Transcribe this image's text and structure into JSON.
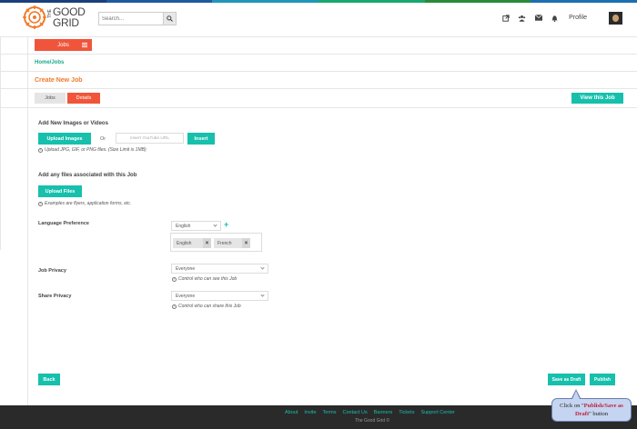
{
  "header": {
    "logo_the": "THE",
    "logo_good": "GOOD",
    "logo_grid": "GRID",
    "search_placeholder": "Search...",
    "profile_label": "Profile",
    "stripe_colors": [
      "#1a3f7a",
      "#1e5aa0",
      "#2196b8",
      "#16a86e",
      "#2a8a3a",
      "#1a6fb0"
    ]
  },
  "menu": {
    "jobs_label": "Jobs"
  },
  "breadcrumb": "Home/Jobs",
  "page_title": "Create New Job",
  "tabs": [
    {
      "label": "Jobs"
    },
    {
      "label": "Details"
    }
  ],
  "view_job_label": "View this Job",
  "images": {
    "title": "Add New Images or Videos",
    "upload_label": "Upload Images",
    "or_label": "Or",
    "url_placeholder": "Insert YouTube URL",
    "insert_label": "Insert",
    "hint": "Upload JPG, GIF, or PNG files.  (Size Limit is 1MB)"
  },
  "files": {
    "title": "Add any files associated with this Job",
    "upload_label": "Upload Files",
    "hint": "Examples are flyers, application forms, etc."
  },
  "language": {
    "label": "Language Preference",
    "select_value": "English",
    "tags": [
      "English",
      "French"
    ]
  },
  "job_privacy": {
    "label": "Job  Privacy",
    "value": "Everyone",
    "hint": "Control who can see this Job"
  },
  "share_privacy": {
    "label": "Share Privacy",
    "value": "Everyone",
    "hint": "Control who can share  this Job"
  },
  "actions": {
    "back_label": "Back",
    "draft_label": "Save as Draft",
    "publish_label": "Publish"
  },
  "footer": {
    "links": [
      "About",
      "Invite",
      "Terms",
      "Contact Us",
      "Banners",
      "Tickets",
      "Support Center"
    ],
    "copyright": "The Good Grid ©"
  },
  "callout": {
    "prefix": "Click on \"",
    "emphasis": "Publish/Save as Draft",
    "suffix": "\" button"
  },
  "colors": {
    "accent_orange": "#f0553b",
    "accent_teal": "#16c0ac",
    "title_orange": "#f07a2a",
    "footer_bg": "#2a2a2a"
  }
}
